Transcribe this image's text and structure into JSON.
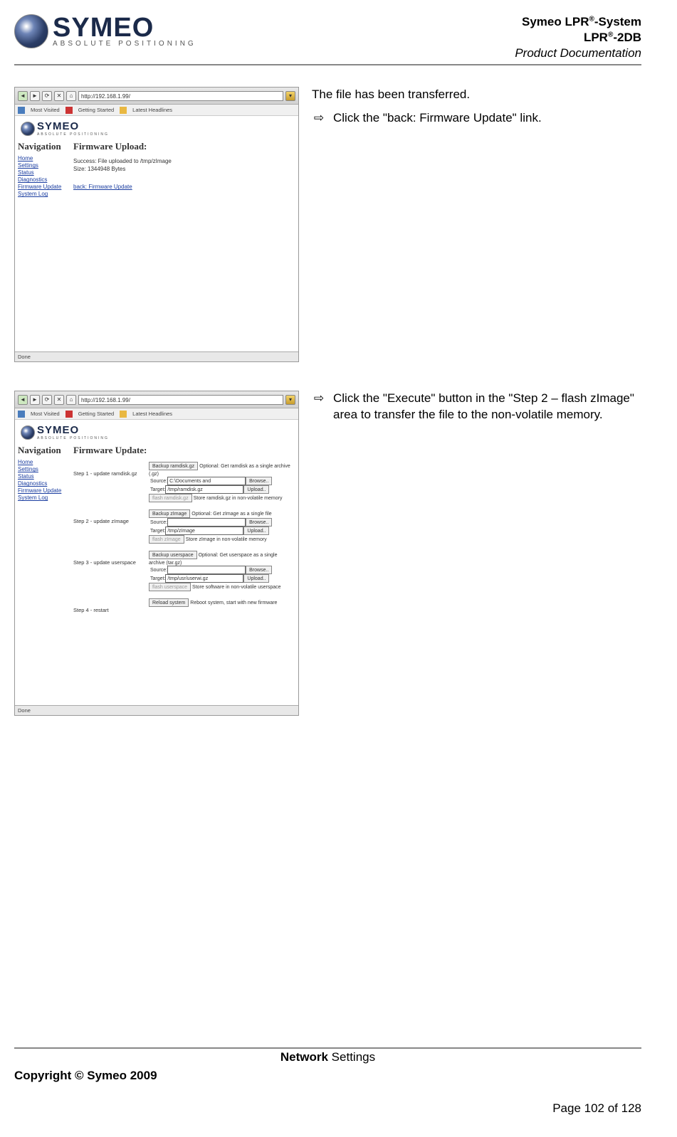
{
  "header": {
    "logo_name": "SYMEO",
    "logo_tag": "ABSOLUTE POSITIONING",
    "title_line1_a": "Symeo LPR",
    "title_line1_b": "-System",
    "title_line2_a": "LPR",
    "title_line2_b": "-2DB",
    "title_line3": "Product Documentation"
  },
  "instr1": {
    "text1": "The file has been transferred.",
    "arrow": "⇨",
    "text2": "Click the \"back: Firmware Update\" link."
  },
  "instr2": {
    "arrow": "⇨",
    "text": "Click the \"Execute\" button in the \"Step 2 – flash zImage\" area to transfer the file to the non-volatile memory."
  },
  "screenshot_common": {
    "url": "http://192.168.1.99/",
    "bookmarks": {
      "most": "Most Visited",
      "getting": "Getting Started",
      "latest": "Latest Headlines"
    },
    "logo_name": "SYMEO",
    "logo_tag": "ABSOLUTE POSITIONING",
    "nav_title": "Navigation",
    "nav_items": [
      "Home",
      "Settings",
      "Status",
      "Diagnostics",
      "Firmware Update",
      "System Log"
    ],
    "status": "Done"
  },
  "ss1": {
    "title": "Firmware Upload:",
    "success": "Success: File uploaded to /tmp/zImage",
    "size": "Size: 1344948 Bytes",
    "back_link": "back: Firmware Update"
  },
  "ss2": {
    "title": "Firmware Update:",
    "step1_label": "Step 1 - update ramdisk.gz",
    "step2_label": "Step 2 - update zImage",
    "step3_label": "Step 3 - update userspace",
    "step4_label": "Step 4 - restart",
    "backup_ramdisk": "Backup ramdisk.gz",
    "backup_zimage": "Backup zImage",
    "backup_userspace": "Backup userspace",
    "opt_ramdisk": "Optional: Get ramdisk as a single archive (.gz)",
    "opt_zimage": "Optional: Get zImage as a single file",
    "opt_userspace": "Optional: Get userspace as a single archive (tar.gz)",
    "source_lbl": "Source:",
    "target_lbl": "Target:",
    "browse": "Browse..",
    "upload": "Upload..",
    "src1": "C:\\Documents and Settings\\prausd",
    "tgt1": "/tmp/ramdisk.gz",
    "tgt2": "/tmp/zImage",
    "tgt3": "/tmp/usr/userwi.gz",
    "flash_ramdisk": "flash ramdisk.gz",
    "flash_zimage": "flash zImage",
    "flash_userspace": "flash userspace",
    "store_ramdisk": "Store ramdisk.gz in non-volatile memory",
    "store_zimage": "Store zImage in non-volatile memory",
    "store_userspace": "Store software in non-volatile userspace",
    "reload": "Reload system",
    "reboot": "Reboot system, start with new firmware"
  },
  "footer": {
    "section_b": "Network",
    "section_r": " Settings",
    "copyright": "Copyright © Symeo 2009",
    "page": "Page 102 of 128"
  }
}
